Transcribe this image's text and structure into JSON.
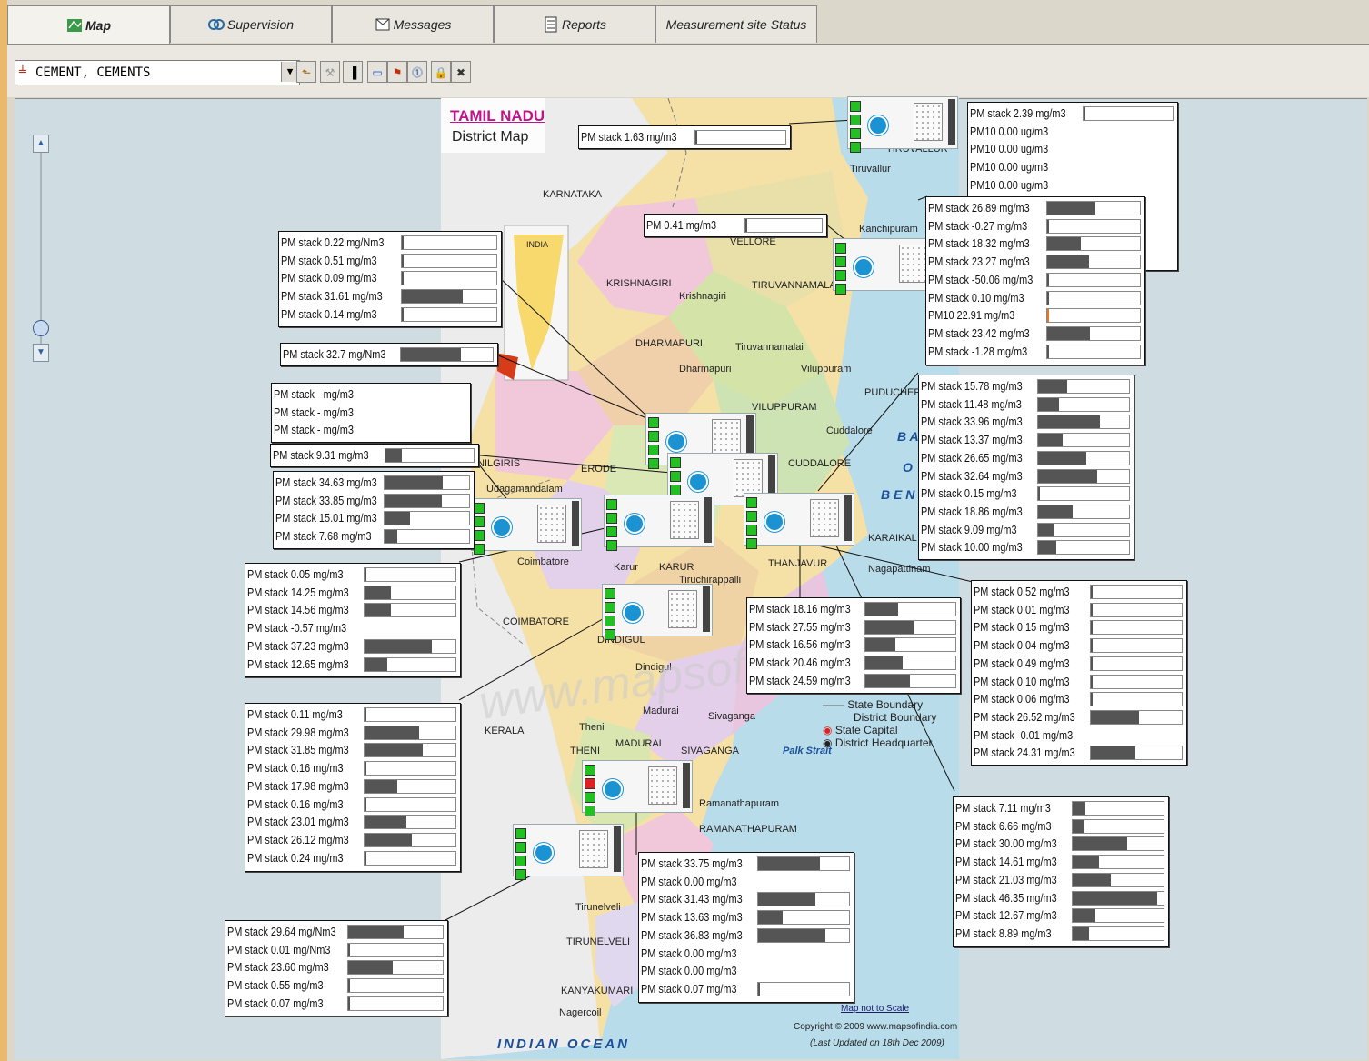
{
  "tabs": [
    {
      "label": "Map",
      "icon": "map-icon",
      "active": true
    },
    {
      "label": "Supervision",
      "icon": "supervision-icon",
      "active": false
    },
    {
      "label": "Messages",
      "icon": "messages-icon",
      "active": false
    },
    {
      "label": "Reports",
      "icon": "reports-icon",
      "active": false
    },
    {
      "label": "Measurement site Status",
      "icon": "",
      "active": false
    }
  ],
  "toolbar": {
    "site_select_value": "CEMENT, CEMENTS"
  },
  "map": {
    "title": "TAMIL NADU",
    "subtitle": "District Map",
    "places": [
      "KARNATAKA",
      "INDIA",
      "VELLORE",
      "Kanchipuram",
      "Tiruvallur",
      "TIRUVALLUR",
      "KRISHNAGIRI",
      "Krishnagiri",
      "TIRUVANNAMALAI",
      "DHARMAPURI",
      "Dharmapuri",
      "Tiruvannamalai",
      "Viluppuram",
      "PUDUCHERRY",
      "VILUPPURAM",
      "Cuddalore",
      "CUDDALORE",
      "NILGIRIS",
      "Udagamandalam",
      "ERODE",
      "Coimbatore",
      "COIMBATORE",
      "KARUR",
      "Karur",
      "Tiruchirappalli",
      "DINDIGUL",
      "Dindigul",
      "THANJAVUR",
      "Nagapattinam",
      "KARAIKAL",
      "Madurai",
      "MADURAI",
      "Theni",
      "THENI",
      "Sivaganga",
      "SIVAGANGA",
      "Palk Strait",
      "Ramanathapuram",
      "RAMANATHAPURAM",
      "KERALA",
      "Tirunelveli",
      "TIRUNELVELI",
      "KANYAKUMARI",
      "Nagercoil",
      "INDIAN   OCEAN",
      "B A",
      "O",
      "B E N"
    ],
    "legend": [
      "State Boundary",
      "District Boundary",
      "State Capital",
      "District Headquarter"
    ],
    "scale_note": "Map not to Scale",
    "copyright": "Copyright © 2009 www.mapsofindia.com",
    "updated": "(Last Updated on 18th Dec 2009)",
    "watermark": "www.mapsofindia.com"
  },
  "colors": {
    "bar_fill": "#555555",
    "bar_alert": "#e87722",
    "led_ok": "#22c022",
    "led_alarm": "#e02020",
    "canvas_bg": "#cfdde3"
  },
  "boxes": [
    {
      "name": "box-top-center",
      "rows": [
        [
          "PM stack  1.63 mg/m3",
          0.02
        ]
      ]
    },
    {
      "name": "box-top-right",
      "rows": [
        [
          "PM stack  2.39 mg/m3",
          0.02
        ],
        [
          "PM10      0.00 ug/m3",
          null
        ],
        [
          "PM10      0.00 ug/m3",
          null
        ],
        [
          "PM10      0.00 ug/m3",
          null
        ],
        [
          "PM10      0.00 ug/m3",
          null
        ]
      ]
    },
    {
      "name": "box-pm041",
      "rows": [
        [
          "PM  0.41 mg/m3",
          0.01
        ]
      ]
    },
    {
      "name": "box-right-2",
      "rows": [
        [
          "PM stack  26.89 mg/m3",
          0.52
        ],
        [
          "PM stack   -0.27 mg/m3",
          0
        ],
        [
          "PM stack  18.32 mg/m3",
          0.36
        ],
        [
          "PM stack  23.27 mg/m3",
          0.45
        ],
        [
          "PM stack -50.06 mg/m3",
          0
        ],
        [
          "PM stack    0.10 mg/m3",
          0.01
        ],
        [
          "PM10      22.91 mg/m3",
          0.02,
          "alert"
        ],
        [
          "PM stack  23.42 mg/m3",
          0.46
        ],
        [
          "PM stack   -1.28 mg/m3",
          0
        ]
      ]
    },
    {
      "name": "box-left-1",
      "rows": [
        [
          "PM stack   0.22 mg/Nm3",
          0.01
        ],
        [
          "PM stack   0.51 mg/m3",
          0.01
        ],
        [
          "PM stack   0.09 mg/m3",
          0.01
        ],
        [
          "PM stack  31.61 mg/m3",
          0.64
        ],
        [
          "PM stack   0.14 mg/m3",
          0.01
        ]
      ]
    },
    {
      "name": "box-left-2",
      "rows": [
        [
          "PM stack  32.7 mg/Nm3",
          0.65
        ]
      ]
    },
    {
      "name": "box-left-3",
      "rows": [
        [
          "PM stack   - mg/m3",
          null
        ],
        [
          "PM stack   - mg/m3",
          null
        ],
        [
          "PM stack   - mg/m3",
          null
        ]
      ]
    },
    {
      "name": "box-left-4",
      "rows": [
        [
          "PM stack  9.31 mg/m3",
          0.19
        ]
      ]
    },
    {
      "name": "box-left-5",
      "rows": [
        [
          "PM stack  34.63 mg/m3",
          0.69
        ],
        [
          "PM stack  33.85 mg/m3",
          0.68
        ],
        [
          "PM stack  15.01 mg/m3",
          0.3
        ],
        [
          "PM stack   7.68 mg/m3",
          0.15
        ]
      ]
    },
    {
      "name": "box-right-3",
      "rows": [
        [
          "PM stack  15.78 mg/m3",
          0.32
        ],
        [
          "PM stack  11.48 mg/m3",
          0.23
        ],
        [
          "PM stack  33.96 mg/m3",
          0.68
        ],
        [
          "PM stack  13.37 mg/m3",
          0.27
        ],
        [
          "PM stack  26.65 mg/m3",
          0.53
        ],
        [
          "PM stack  32.64 mg/m3",
          0.65
        ],
        [
          "PM stack    0.15 mg/m3",
          0.01
        ],
        [
          "PM stack  18.86 mg/m3",
          0.38
        ],
        [
          "PM stack    9.09 mg/m3",
          0.18
        ],
        [
          "PM stack  10.00 mg/m3",
          0.2
        ]
      ]
    },
    {
      "name": "box-left-6",
      "rows": [
        [
          "PM stack   0.05 mg/m3",
          0.01
        ],
        [
          "PM stack  14.25 mg/m3",
          0.29
        ],
        [
          "PM stack  14.56 mg/m3",
          0.29
        ],
        [
          "PM stack  -0.57 mg/m3",
          null
        ],
        [
          "PM stack  37.23 mg/m3",
          0.74
        ],
        [
          "PM stack  12.65 mg/m3",
          0.25
        ]
      ]
    },
    {
      "name": "box-center",
      "rows": [
        [
          "PM stack  18.16 mg/m3",
          0.36
        ],
        [
          "PM stack  27.55 mg/m3",
          0.55
        ],
        [
          "PM stack  16.56 mg/m3",
          0.33
        ],
        [
          "PM stack  20.46 mg/m3",
          0.41
        ],
        [
          "PM stack  24.59 mg/m3",
          0.49
        ]
      ]
    },
    {
      "name": "box-right-4",
      "rows": [
        [
          "PM stack   0.52 mg/m3",
          0.01
        ],
        [
          "PM stack   0.01 mg/m3",
          0.01
        ],
        [
          "PM stack   0.15 mg/m3",
          0.01
        ],
        [
          "PM stack   0.04 mg/m3",
          0.01
        ],
        [
          "PM stack   0.49 mg/m3",
          0.01
        ],
        [
          "PM stack   0.10 mg/m3",
          0.01
        ],
        [
          "PM stack   0.06 mg/m3",
          0.01
        ],
        [
          "PM stack  26.52 mg/m3",
          0.53
        ],
        [
          "PM stack  -0.01 mg/m3",
          null
        ],
        [
          "PM stack  24.31 mg/m3",
          0.49
        ]
      ]
    },
    {
      "name": "box-left-7",
      "rows": [
        [
          "PM stack   0.11 mg/m3",
          0.01
        ],
        [
          "PM stack  29.98 mg/m3",
          0.6
        ],
        [
          "PM stack  31.85 mg/m3",
          0.64
        ],
        [
          "PM stack   0.16 mg/m3",
          0.01
        ],
        [
          "PM stack  17.98 mg/m3",
          0.36
        ],
        [
          "PM stack   0.16 mg/m3",
          0.01
        ],
        [
          "PM stack  23.01 mg/m3",
          0.46
        ],
        [
          "PM stack  26.12 mg/m3",
          0.52
        ],
        [
          "PM stack   0.24 mg/m3",
          0.01
        ]
      ]
    },
    {
      "name": "box-right-5",
      "rows": [
        [
          "PM stack   7.11 mg/m3",
          0.14
        ],
        [
          "PM stack   6.66 mg/m3",
          0.13
        ],
        [
          "PM stack  30.00 mg/m3",
          0.6
        ],
        [
          "PM stack  14.61 mg/m3",
          0.29
        ],
        [
          "PM stack  21.03 mg/m3",
          0.42
        ],
        [
          "PM stack  46.35 mg/m3",
          0.93
        ],
        [
          "PM stack  12.67 mg/m3",
          0.25
        ],
        [
          "PM stack   8.89 mg/m3",
          0.18
        ]
      ]
    },
    {
      "name": "box-bottom-center",
      "rows": [
        [
          "PM stack  33.75 mg/m3",
          0.68
        ],
        [
          "PM stack   0.00 mg/m3",
          null
        ],
        [
          "PM stack  31.43 mg/m3",
          0.63
        ],
        [
          "PM stack  13.63 mg/m3",
          0.27
        ],
        [
          "PM stack  36.83 mg/m3",
          0.74
        ],
        [
          "PM stack   0.00 mg/m3",
          null
        ],
        [
          "PM stack   0.00 mg/m3",
          null
        ],
        [
          "PM stack   0.07 mg/m3",
          0.01
        ]
      ]
    },
    {
      "name": "box-bottom-left",
      "rows": [
        [
          "PM stack  29.64 mg/Nm3",
          0.59
        ],
        [
          "PM stack   0.01 mg/Nm3",
          0.01
        ],
        [
          "PM stack  23.60 mg/m3",
          0.47
        ],
        [
          "PM stack   0.55 mg/m3",
          0.01
        ],
        [
          "PM stack   0.07 mg/m3",
          0.01
        ]
      ]
    }
  ],
  "devices": [
    {
      "name": "device-top",
      "leds": [
        "ok",
        "ok",
        "ok",
        "ok"
      ]
    },
    {
      "name": "device-tiruvannamalai",
      "leds": [
        "ok",
        "ok",
        "ok",
        "ok"
      ]
    },
    {
      "name": "device-salem",
      "leds": [
        "ok",
        "ok",
        "ok",
        "ok"
      ]
    },
    {
      "name": "device-namakkal",
      "leds": [
        "ok",
        "ok",
        "ok",
        "ok"
      ]
    },
    {
      "name": "device-coimbatore",
      "leds": [
        "ok",
        "ok",
        "ok",
        "ok"
      ]
    },
    {
      "name": "device-karur",
      "leds": [
        "ok",
        "ok",
        "ok",
        "ok"
      ]
    },
    {
      "name": "device-perambalur",
      "leds": [
        "ok",
        "ok",
        "ok",
        "ok"
      ]
    },
    {
      "name": "device-dindigul",
      "leds": [
        "ok",
        "ok",
        "ok",
        "ok"
      ]
    },
    {
      "name": "device-virudhunagar",
      "leds": [
        "ok",
        "alarm",
        "ok",
        "ok"
      ]
    },
    {
      "name": "device-tirunelveli",
      "leds": [
        "ok",
        "ok",
        "ok",
        "ok"
      ]
    }
  ]
}
